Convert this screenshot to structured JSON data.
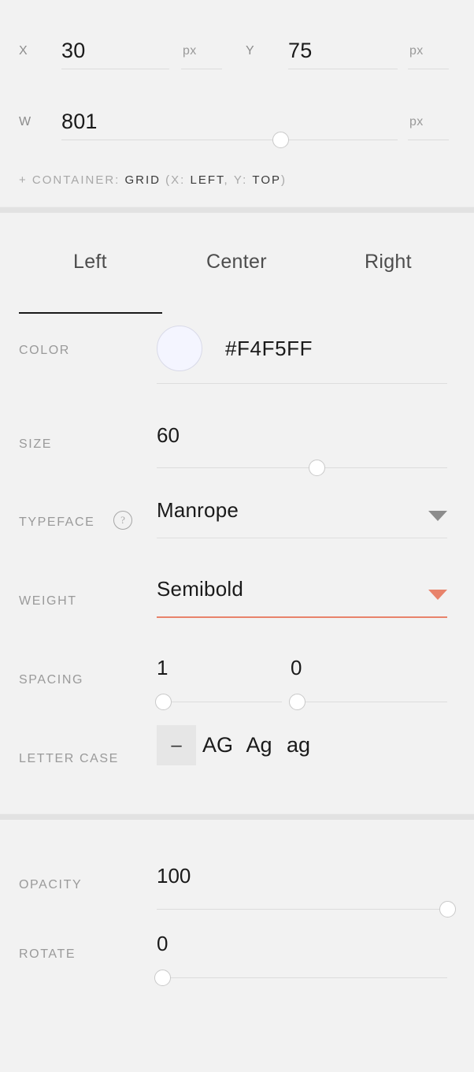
{
  "accent": "#E8836B",
  "geometry": {
    "x": {
      "label": "X",
      "value": "30",
      "unit": "px"
    },
    "y": {
      "label": "Y",
      "value": "75",
      "unit": "px"
    },
    "w": {
      "label": "W",
      "value": "801",
      "unit": "px",
      "slider_percent": 65
    }
  },
  "container": {
    "prefix": "+ CONTAINER:",
    "type": "GRID",
    "open_paren": "(",
    "x_key": "X:",
    "x_value": "LEFT",
    "comma": ",",
    "y_key": "Y:",
    "y_value": "TOP",
    "close_paren": ")"
  },
  "tabs": [
    {
      "label": "Left",
      "active": true
    },
    {
      "label": "Center",
      "active": false
    },
    {
      "label": "Right",
      "active": false
    }
  ],
  "typography": {
    "color": {
      "label": "COLOR",
      "hex": "#F4F5FF",
      "swatch": "#F4F5FF"
    },
    "size": {
      "label": "SIZE",
      "value": "60",
      "slider_percent": 55
    },
    "typeface": {
      "label": "TYPEFACE",
      "value": "Manrope",
      "help_glyph": "?"
    },
    "weight": {
      "label": "WEIGHT",
      "value": "Semibold"
    },
    "spacing": {
      "label": "SPACING",
      "value_1": "1",
      "value_2": "0",
      "slider_1_percent": 5,
      "slider_2_percent": 4
    },
    "letter_case": {
      "label": "LETTER CASE",
      "options": [
        {
          "label": "–",
          "selected": true
        },
        {
          "label": "AG",
          "selected": false
        },
        {
          "label": "Ag",
          "selected": false
        },
        {
          "label": "ag",
          "selected": false
        }
      ]
    }
  },
  "transform": {
    "opacity": {
      "label": "OPACITY",
      "value": "100",
      "slider_percent": 100
    },
    "rotate": {
      "label": "ROTATE",
      "value": "0",
      "slider_percent": 2
    }
  }
}
